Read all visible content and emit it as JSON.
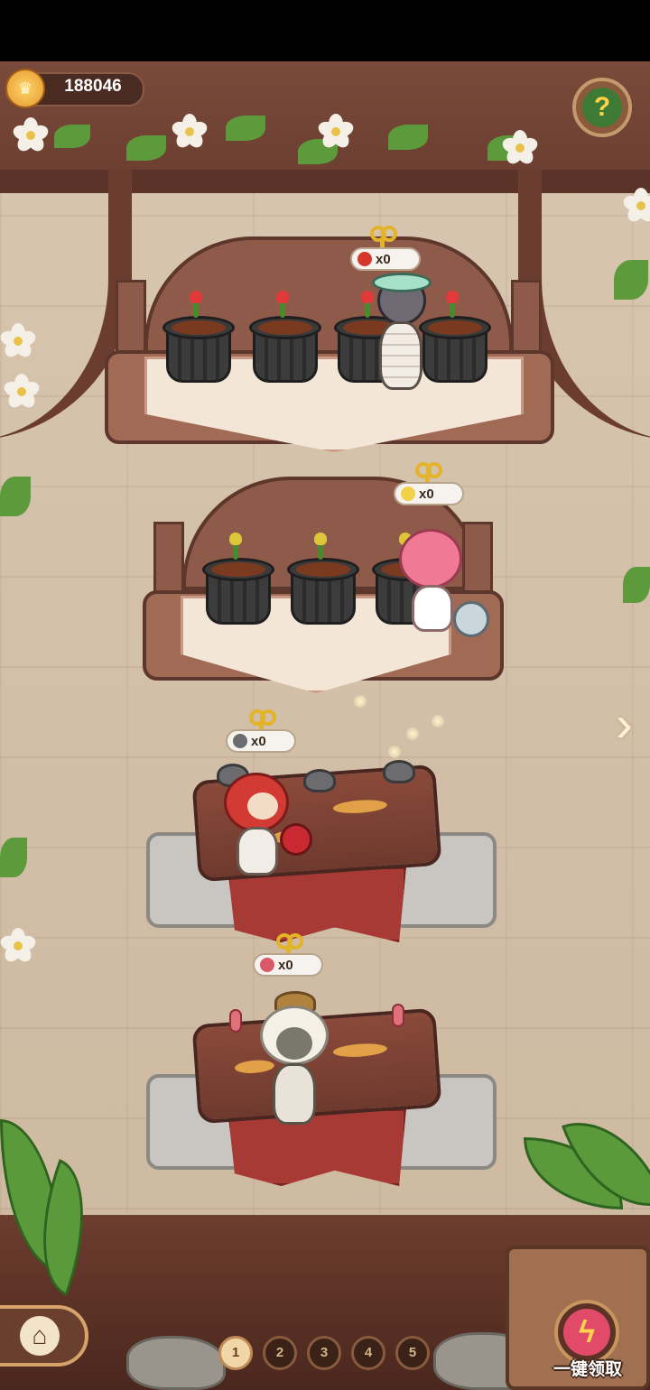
{
  "currency": {
    "icon": "crown-coin-icon",
    "amount": "188046"
  },
  "help_button": {
    "icon": "question-sprout-icon",
    "glyph": "?"
  },
  "stations": [
    {
      "name": "mummy-flower-shelf",
      "reward_icon": "chili-pepper-icon",
      "reward_count": "x0",
      "character": "mummy-character"
    },
    {
      "name": "pink-hair-flower-shelf",
      "reward_icon": "yellow-flower-icon",
      "reward_count": "x0",
      "character": "pink-hair-girl-character"
    },
    {
      "name": "red-hair-log-station",
      "reward_icon": "grey-rock-bug-icon",
      "reward_count": "x0",
      "character": "red-hair-girl-character"
    },
    {
      "name": "white-hair-log-station",
      "reward_icon": "red-worm-icon",
      "reward_count": "x0",
      "character": "white-hair-boy-character"
    }
  ],
  "navigation": {
    "home_icon": "home-icon",
    "home_glyph": "⌂",
    "next_arrow": "›"
  },
  "pages": [
    "1",
    "2",
    "3",
    "4",
    "5"
  ],
  "active_page": "1",
  "collect_all": {
    "label": "一键领取",
    "glyph": "ϟ",
    "icon": "lightning-bolt-icon"
  },
  "colors": {
    "accent_gold": "#e3b32a",
    "wood": "#8e5a4a",
    "badge_bg": "#f6f3ee"
  }
}
